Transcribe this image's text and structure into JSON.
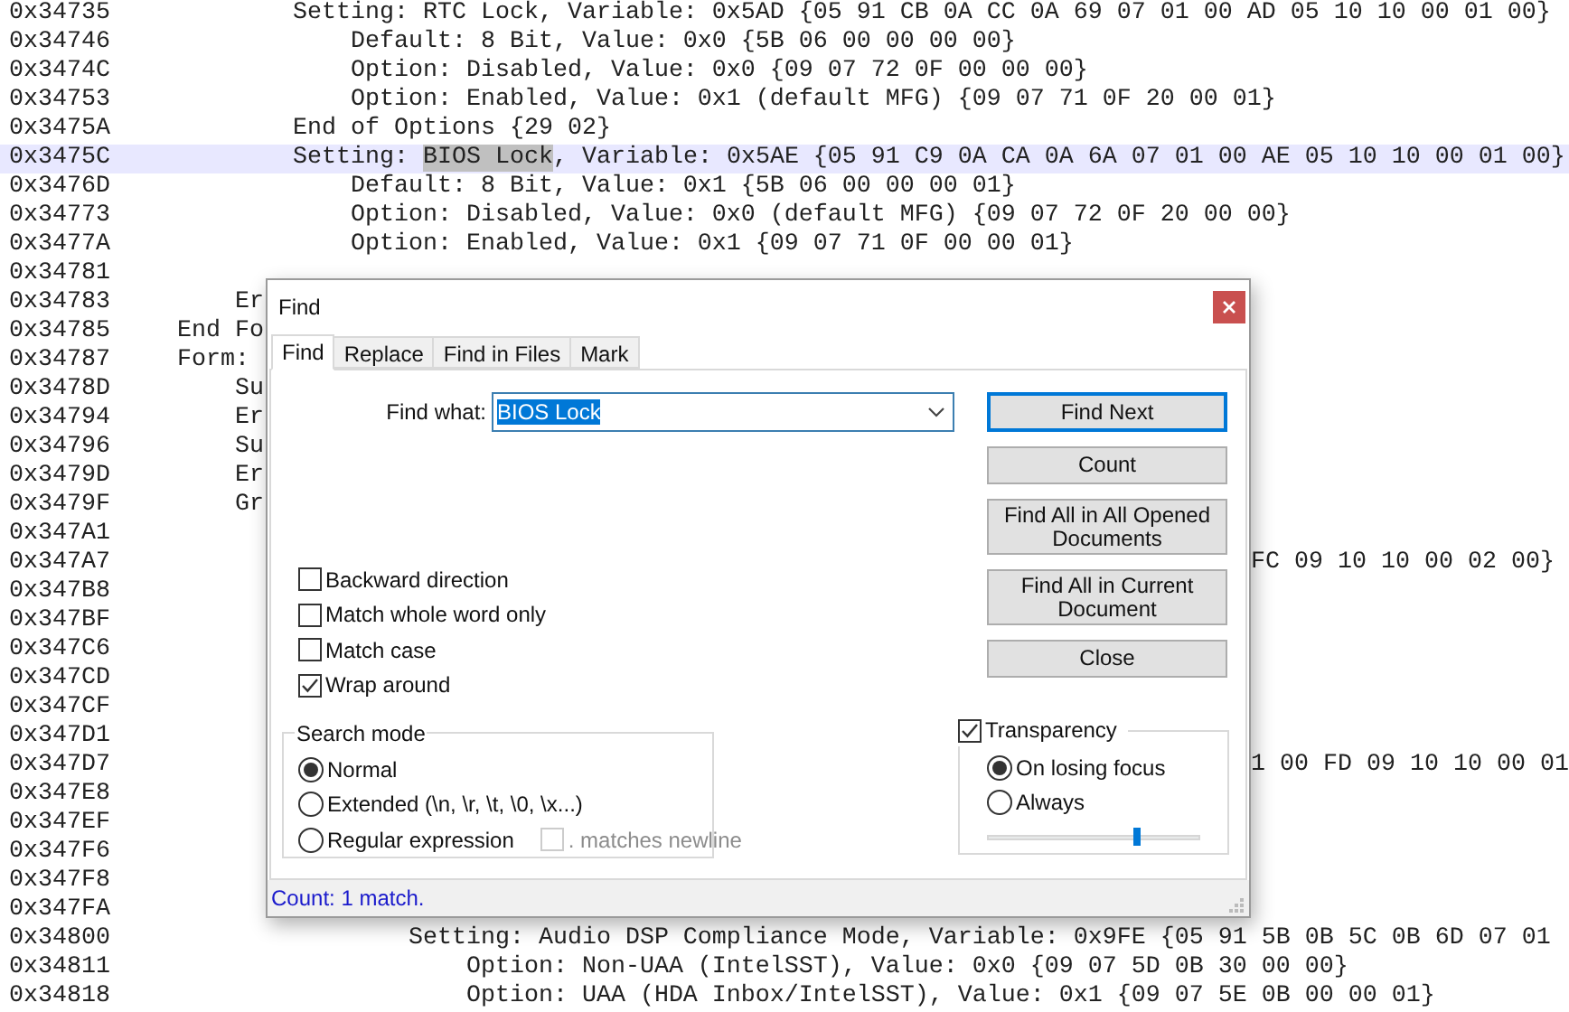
{
  "editor": {
    "rows": [
      {
        "address": "0x34735",
        "text": "        Setting: RTC Lock, Variable: 0x5AD {05 91 CB 0A CC 0A 69 07 01 00 AD 05 10 10 00 01 00}"
      },
      {
        "address": "0x34746",
        "text": "            Default: 8 Bit, Value: 0x0 {5B 06 00 00 00 00}"
      },
      {
        "address": "0x3474C",
        "text": "            Option: Disabled, Value: 0x0 {09 07 72 0F 00 00 00}"
      },
      {
        "address": "0x34753",
        "text": "            Option: Enabled, Value: 0x1 (default MFG) {09 07 71 0F 20 00 01}"
      },
      {
        "address": "0x3475A",
        "text": "        End of Options {29 02}"
      },
      {
        "address": "0x3475C",
        "current": true,
        "text": "        Setting: ",
        "match": "BIOS Lock",
        "after": ", Variable: 0x5AE {05 91 C9 0A CA 0A 6A 07 01 00 AE 05 10 10 00 01 00}"
      },
      {
        "address": "0x3476D",
        "text": "            Default: 8 Bit, Value: 0x1 {5B 06 00 00 00 01}"
      },
      {
        "address": "0x34773",
        "text": "            Option: Disabled, Value: 0x0 (default MFG) {09 07 72 0F 20 00 00}"
      },
      {
        "address": "0x3477A",
        "text": "            Option: Enabled, Value: 0x1 {09 07 71 0F 00 00 01}"
      },
      {
        "address": "0x34781"
      },
      {
        "address": "0x34783",
        "text": "    Er"
      },
      {
        "address": "0x34785",
        "text": "End Fo"
      },
      {
        "address": "0x34787",
        "text": "Form:"
      },
      {
        "address": "0x3478D",
        "text": "    Su"
      },
      {
        "address": "0x34794",
        "text": "    Er"
      },
      {
        "address": "0x34796",
        "text": "    Su"
      },
      {
        "address": "0x3479D",
        "text": "    Er"
      },
      {
        "address": "0x3479F",
        "text": "    Gr"
      },
      {
        "address": "0x347A1"
      },
      {
        "address": "0x347A7",
        "tail": "FC 09 10 10 00 02 00}"
      },
      {
        "address": "0x347B8"
      },
      {
        "address": "0x347BF"
      },
      {
        "address": "0x347C6"
      },
      {
        "address": "0x347CD"
      },
      {
        "address": "0x347CF"
      },
      {
        "address": "0x347D1"
      },
      {
        "address": "0x347D7",
        "tail": "1 00 FD 09 10 10 00 01"
      },
      {
        "address": "0x347E8"
      },
      {
        "address": "0x347EF"
      },
      {
        "address": "0x347F6"
      },
      {
        "address": "0x347F8"
      },
      {
        "address": "0x347FA"
      },
      {
        "address": "0x34800",
        "text": "                Setting: Audio DSP Compliance Mode, Variable: 0x9FE {05 91 5B 0B 5C 0B 6D 07 01"
      },
      {
        "address": "0x34811",
        "text": "                    Option: Non-UAA (IntelSST), Value: 0x0 {09 07 5D 0B 30 00 00}"
      },
      {
        "address": "0x34818",
        "text": "                    Option: UAA (HDA Inbox/IntelSST), Value: 0x1 {09 07 5E 0B 00 00 01}"
      }
    ]
  },
  "dialog": {
    "title": "Find",
    "tabs": [
      {
        "label": "Find",
        "selected": true
      },
      {
        "label": "Replace",
        "selected": false
      },
      {
        "label": "Find in Files",
        "selected": false
      },
      {
        "label": "Mark",
        "selected": false
      }
    ],
    "find_what": {
      "label": "Find what:",
      "value": "BIOS Lock"
    },
    "buttons": [
      {
        "label": "Find Next",
        "focused": true
      },
      {
        "label": "Count",
        "focused": false
      },
      {
        "label": "Find All in All Opened Documents",
        "focused": false
      },
      {
        "label": "Find All in Current Document",
        "focused": false
      },
      {
        "label": "Close",
        "focused": false
      }
    ],
    "options": [
      {
        "label": "Backward direction",
        "checked": false
      },
      {
        "label": "Match whole word only",
        "checked": false
      },
      {
        "label": "Match case",
        "checked": false
      },
      {
        "label": "Wrap around",
        "checked": true
      }
    ],
    "search_mode": {
      "title": "Search mode",
      "modes": [
        {
          "label": "Normal",
          "selected": true
        },
        {
          "label": "Extended (\\n, \\r, \\t, \\0, \\x...)",
          "selected": false
        },
        {
          "label": "Regular expression",
          "selected": false
        }
      ],
      "matches_newline": {
        "label": ". matches newline",
        "checked": false,
        "disabled": true
      }
    },
    "transparency": {
      "label": "Transparency",
      "checked": true,
      "modes": [
        {
          "label": "On losing focus",
          "selected": true
        },
        {
          "label": "Always",
          "selected": false
        }
      ],
      "level": 0.7
    },
    "status": "Count: 1 match."
  }
}
